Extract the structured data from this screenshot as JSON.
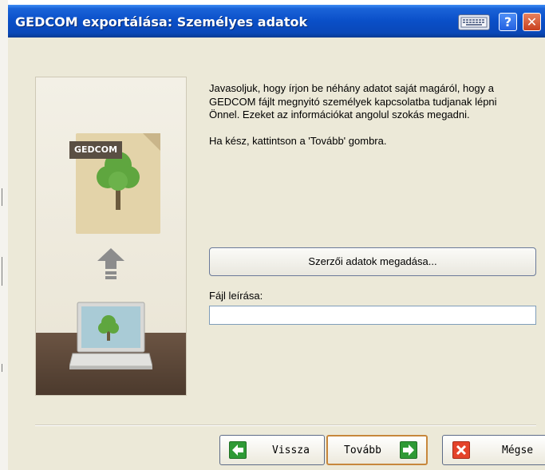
{
  "window": {
    "title": "GEDCOM exportálása: Személyes adatok"
  },
  "titlebar_icons": {
    "keyboard": "keyboard-icon",
    "help": "?",
    "close": "✕"
  },
  "illustration": {
    "file_label": "GEDCOM"
  },
  "content": {
    "paragraph1": "Javasoljuk, hogy írjon be néhány adatot saját magáról, hogy a GEDCOM fájlt megnyitó személyek kapcsolatba tudjanak lépni Önnel. Ezeket az információkat angolul szokás megadni.",
    "paragraph2": "Ha kész, kattintson a 'Tovább' gombra."
  },
  "form": {
    "author_button_label": "Szerzői adatok megadása...",
    "file_description_label": "Fájl leírása:",
    "file_description_value": ""
  },
  "buttons": {
    "back_label": "Vissza",
    "next_label": "Tovább",
    "cancel_label": "Mégse"
  },
  "colors": {
    "titlebar": "#0a4fc8",
    "dialog_bg": "#ece9d8",
    "green_icon": "#2f9a36",
    "red_icon": "#e4432a"
  }
}
